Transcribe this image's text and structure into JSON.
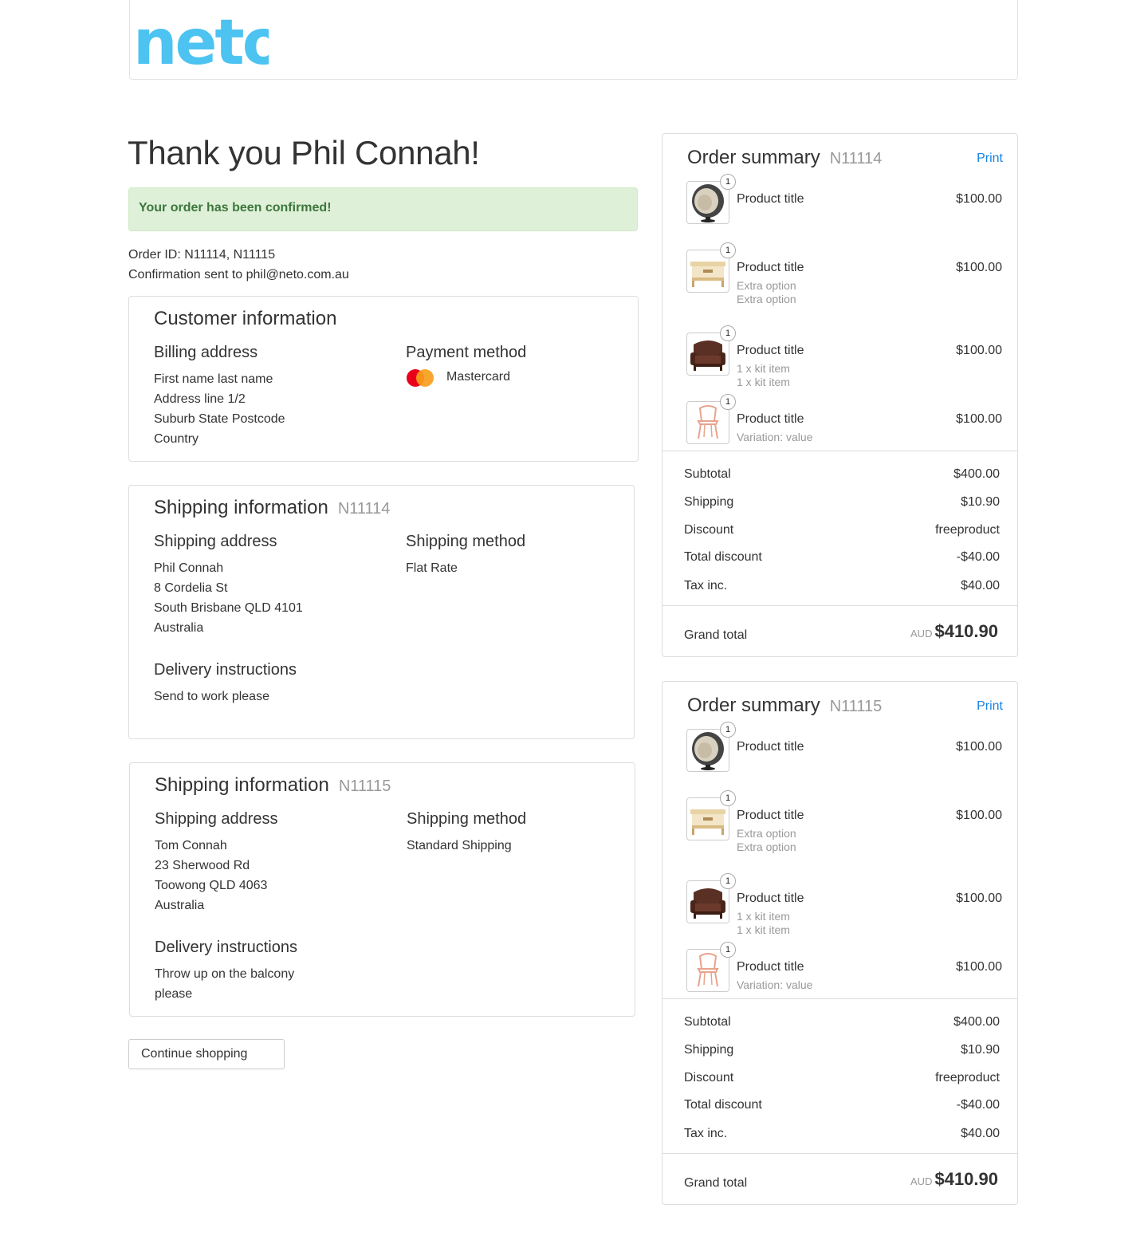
{
  "brand": {
    "logo_text": "neto",
    "logo_color": "#4cc3f1"
  },
  "page": {
    "thanks": "Thank you Phil Connah!",
    "alert": "Your order has been confirmed!",
    "order_ids": "Order ID: N11114, N11115",
    "confirmation": "Confirmation sent to phil@neto.com.au"
  },
  "customer": {
    "title": "Customer information",
    "billing_heading": "Billing address",
    "billing_lines": [
      "First name last name",
      "Address line 1/2",
      "Suburb State Postcode",
      "Country"
    ],
    "payment_heading": "Payment method",
    "payment_method": "Mastercard",
    "payment_icon": "mastercard-icon"
  },
  "shipping": [
    {
      "title": "Shipping information",
      "order": "N11114",
      "address_heading": "Shipping address",
      "address_lines": [
        "Phil Connah",
        "8 Cordelia St",
        "South Brisbane QLD 4101",
        "Australia"
      ],
      "method_heading": "Shipping method",
      "method": "Flat Rate",
      "instructions_heading": "Delivery instructions",
      "instructions": "Send to work please"
    },
    {
      "title": "Shipping information",
      "order": "N11115",
      "address_heading": "Shipping address",
      "address_lines": [
        "Tom Connah",
        "23 Sherwood Rd",
        "Toowong QLD 4063",
        "Australia"
      ],
      "method_heading": "Shipping method",
      "method": "Standard Shipping",
      "instructions_heading": "Delivery instructions",
      "instructions_lines": [
        "Throw up on the balcony",
        "please"
      ]
    }
  ],
  "continue_label": "Continue shopping",
  "summaries": [
    {
      "title": "Order summary",
      "order": "N11114",
      "print": "Print",
      "items": [
        {
          "qty": "1",
          "title": "Product title",
          "price": "$100.00",
          "thumb": "egg-chair-icon",
          "options": []
        },
        {
          "qty": "1",
          "title": "Product title",
          "price": "$100.00",
          "thumb": "coffee-table-icon",
          "options": [
            "Extra option",
            "Extra option"
          ]
        },
        {
          "qty": "1",
          "title": "Product title",
          "price": "$100.00",
          "thumb": "sofa-icon",
          "options": [
            "1 x kit item",
            "1 x kit item"
          ]
        },
        {
          "qty": "1",
          "title": "Product title",
          "price": "$100.00",
          "thumb": "chair-icon",
          "options": [
            "Variation: value"
          ]
        }
      ],
      "totals": [
        {
          "label": "Subtotal",
          "value": "$400.00"
        },
        {
          "label": "Shipping",
          "value": "$10.90"
        },
        {
          "label": "Discount",
          "value": "freeproduct"
        },
        {
          "label": "Total discount",
          "value": "-$40.00"
        },
        {
          "label": "Tax inc.",
          "value": "$40.00"
        }
      ],
      "grand_label": "Grand total",
      "currency": "AUD",
      "grand_value": "$410.90"
    },
    {
      "title": "Order summary",
      "order": "N11115",
      "print": "Print",
      "items": [
        {
          "qty": "1",
          "title": "Product title",
          "price": "$100.00",
          "thumb": "egg-chair-icon",
          "options": []
        },
        {
          "qty": "1",
          "title": "Product title",
          "price": "$100.00",
          "thumb": "coffee-table-icon",
          "options": [
            "Extra option",
            "Extra option"
          ]
        },
        {
          "qty": "1",
          "title": "Product title",
          "price": "$100.00",
          "thumb": "sofa-icon",
          "options": [
            "1 x kit item",
            "1 x kit item"
          ]
        },
        {
          "qty": "1",
          "title": "Product title",
          "price": "$100.00",
          "thumb": "chair-icon",
          "options": [
            "Variation: value"
          ]
        }
      ],
      "totals": [
        {
          "label": "Subtotal",
          "value": "$400.00"
        },
        {
          "label": "Shipping",
          "value": "$10.90"
        },
        {
          "label": "Discount",
          "value": "freeproduct"
        },
        {
          "label": "Total discount",
          "value": "-$40.00"
        },
        {
          "label": "Tax inc.",
          "value": "$40.00"
        }
      ],
      "grand_label": "Grand total",
      "currency": "AUD",
      "grand_value": "$410.90"
    }
  ]
}
